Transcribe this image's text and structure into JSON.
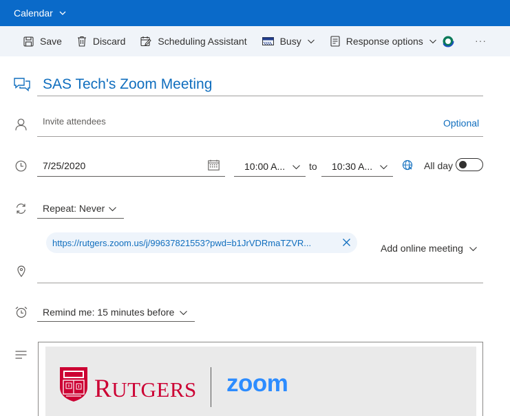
{
  "titlebar": {
    "title": "Calendar"
  },
  "toolbar": {
    "save": "Save",
    "discard": "Discard",
    "scheduling": "Scheduling Assistant",
    "busy": "Busy",
    "response": "Response options",
    "more": "···"
  },
  "event": {
    "title": "SAS Tech's Zoom Meeting",
    "attendees_placeholder": "Invite attendees",
    "optional_label": "Optional",
    "date": "7/25/2020",
    "start_time": "10:00 A...",
    "to_label": "to",
    "end_time": "10:30 A...",
    "all_day_label": "All day",
    "all_day": false,
    "repeat": "Repeat:  Never",
    "meeting_link": "https://rutgers.zoom.us/j/99637821553?pwd=b1JrVDRmaTZVR...",
    "add_online_meeting": "Add online meeting",
    "remind": "Remind me:  15 minutes before"
  },
  "banner": {
    "rutgers_first": "R",
    "rutgers_rest": "UTGERS",
    "zoom": "zoom"
  },
  "colors": {
    "brand_blue": "#106ebe",
    "titlebar": "#0a6ac9",
    "rutgers_red": "#cc0033",
    "zoom_blue": "#2d8cff"
  },
  "icons": [
    "chevron-down-icon",
    "save-icon",
    "trash-icon",
    "scheduling-icon",
    "busy-icon",
    "response-icon",
    "loop-icon",
    "chat-icon",
    "person-icon",
    "clock-icon",
    "calendar-icon",
    "timezone-icon",
    "repeat-icon",
    "close-icon",
    "location-icon",
    "alarm-icon",
    "text-align-icon"
  ]
}
